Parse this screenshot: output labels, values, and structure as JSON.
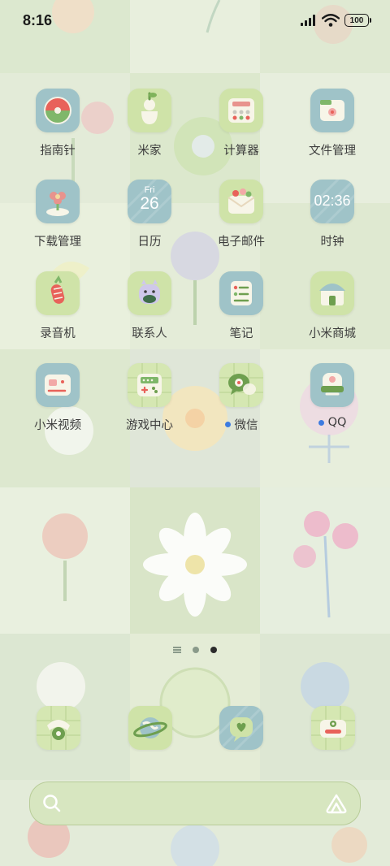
{
  "status_bar": {
    "time": "8:16",
    "battery": "100",
    "icons": [
      "signal-icon",
      "wifi-icon",
      "battery-icon"
    ]
  },
  "apps": [
    {
      "label": "指南针",
      "icon": "compass-icon",
      "notify": false
    },
    {
      "label": "米家",
      "icon": "mijia-icon",
      "notify": false
    },
    {
      "label": "计算器",
      "icon": "calculator-icon",
      "notify": false
    },
    {
      "label": "文件管理",
      "icon": "file-manager-icon",
      "notify": false
    },
    {
      "label": "下载管理",
      "icon": "download-manager-icon",
      "notify": false
    },
    {
      "label": "日历",
      "icon": "calendar-icon",
      "notify": false,
      "day_name": "Fri",
      "day_num": "26"
    },
    {
      "label": "电子邮件",
      "icon": "email-icon",
      "notify": false
    },
    {
      "label": "时钟",
      "icon": "clock-icon",
      "notify": false,
      "clock_text": "02:36"
    },
    {
      "label": "录音机",
      "icon": "recorder-icon",
      "notify": false
    },
    {
      "label": "联系人",
      "icon": "contacts-icon",
      "notify": false
    },
    {
      "label": "笔记",
      "icon": "notes-icon",
      "notify": false
    },
    {
      "label": "小米商城",
      "icon": "mi-store-icon",
      "notify": false
    },
    {
      "label": "小米视频",
      "icon": "mi-video-icon",
      "notify": false
    },
    {
      "label": "游戏中心",
      "icon": "game-center-icon",
      "notify": false
    },
    {
      "label": "微信",
      "icon": "wechat-icon",
      "notify": true
    },
    {
      "label": "QQ",
      "icon": "qq-icon",
      "notify": true
    }
  ],
  "page_indicator": {
    "pages": 2,
    "active": 2
  },
  "dock": [
    {
      "icon": "phone-icon"
    },
    {
      "icon": "browser-icon"
    },
    {
      "icon": "messages-icon"
    },
    {
      "icon": "camera-icon"
    }
  ],
  "search_bar": {
    "icons": [
      "search-icon",
      "assistant-icon"
    ]
  },
  "colors": {
    "accent": "#3d7be0",
    "wallpaper": "#e6efd9",
    "search_bar": "#d7e6c0"
  }
}
